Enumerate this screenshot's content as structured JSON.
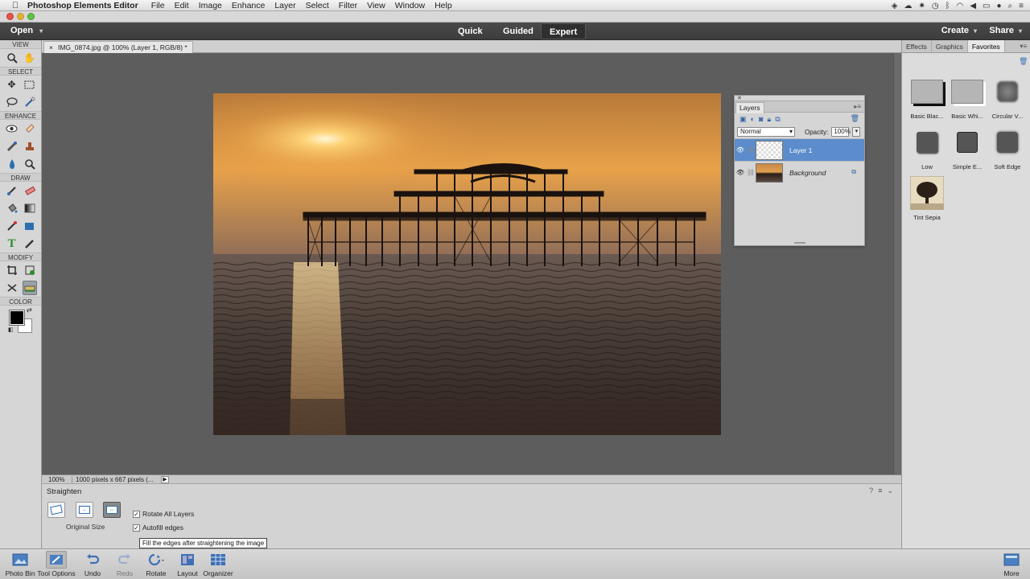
{
  "menubar": {
    "app_name": "Photoshop Elements Editor",
    "items": [
      "File",
      "Edit",
      "Image",
      "Enhance",
      "Layer",
      "Select",
      "Filter",
      "View",
      "Window",
      "Help"
    ]
  },
  "modebar": {
    "open_label": "Open",
    "tabs": [
      "Quick",
      "Guided",
      "Expert"
    ],
    "active_tab": "Expert",
    "create_label": "Create",
    "share_label": "Share"
  },
  "toolbox": {
    "sections": [
      "VIEW",
      "SELECT",
      "ENHANCE",
      "DRAW",
      "MODIFY",
      "COLOR"
    ]
  },
  "document": {
    "tab_title": "IMG_0874.jpg @ 100% (Layer 1, RGB/8) *",
    "tab_close": "×",
    "zoom": "100%",
    "dimensions": "1000 pixels x 667 pixels (..."
  },
  "layers_panel": {
    "title": "Layers",
    "blend_mode": "Normal",
    "opacity_label": "Opacity:",
    "opacity_value": "100%",
    "layers": [
      {
        "name": "Layer 1",
        "active": true
      },
      {
        "name": "Background",
        "active": false
      }
    ]
  },
  "right_panel": {
    "tabs": [
      "Effects",
      "Graphics",
      "Favorites"
    ],
    "active_tab": "Favorites",
    "favorites": [
      "Basic Blac...",
      "Basic Whi...",
      "Circular V...",
      "Low",
      "Simple E...",
      "Soft Edge",
      "Tint Sepia"
    ]
  },
  "tool_options": {
    "title": "Straighten",
    "size_label": "Original Size",
    "rotate_all_layers": "Rotate All Layers",
    "autofill_edges": "Autofill edges",
    "tooltip": "Fill the edges after straightening the image"
  },
  "taskbar": {
    "buttons": [
      "Photo Bin",
      "Tool Options",
      "Undo",
      "Redo",
      "Rotate",
      "Layout",
      "Organizer"
    ],
    "more_label": "More"
  },
  "colors": {
    "accent": "#5c8ccb",
    "foreground": "#000000",
    "background": "#ffffff"
  }
}
